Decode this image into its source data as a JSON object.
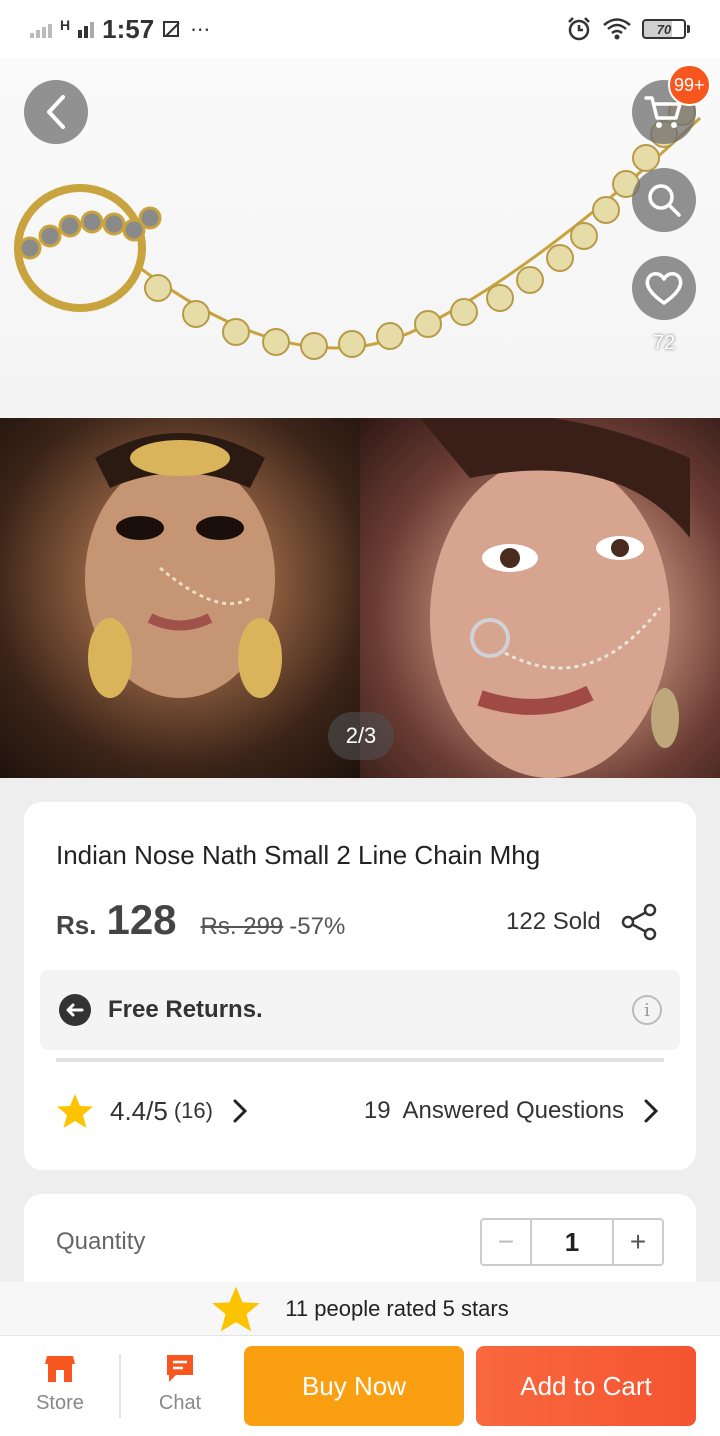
{
  "status_bar": {
    "network": "H",
    "time": "1:57",
    "extra": "⋯",
    "battery": "70"
  },
  "gallery": {
    "page_indicator": "2/3",
    "cart_badge": "99+",
    "wishlist_count": "72"
  },
  "product": {
    "title": "Indian Nose Nath Small 2 Line Chain Mhg",
    "currency": "Rs.",
    "price": "128",
    "original_price": "Rs. 299",
    "discount": "-57%",
    "sold": "122 Sold",
    "free_returns": "Free Returns.",
    "info": "i",
    "rating": "4.4/5",
    "rating_count": "(16)",
    "questions_count": "19",
    "questions_label": "Answered Questions"
  },
  "quantity": {
    "label": "Quantity",
    "value": "1",
    "minus": "−",
    "plus": "+"
  },
  "rating_banner": {
    "text": "11 people rated 5 stars"
  },
  "bottom_bar": {
    "store_label": "Store",
    "chat_label": "Chat",
    "buy_now": "Buy Now",
    "add_to_cart": "Add to Cart"
  },
  "colors": {
    "accent": "#f7571f",
    "buy_now": "#fa9e12",
    "add_to_cart": "#f45430",
    "star": "#fcc400"
  }
}
